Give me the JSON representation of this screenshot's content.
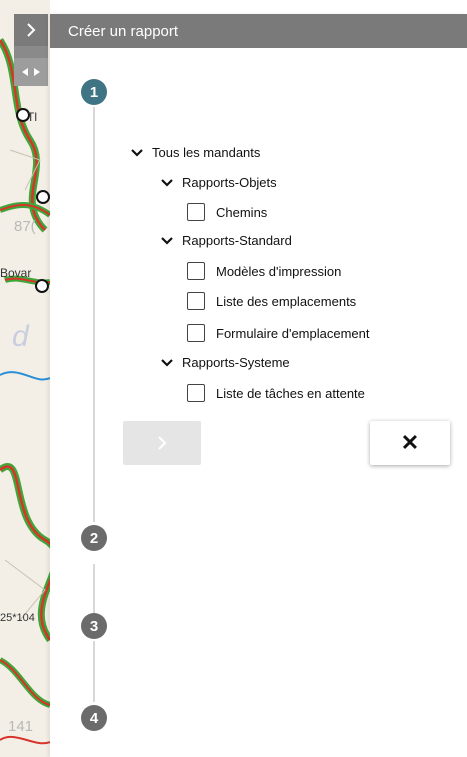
{
  "panel": {
    "title": "Créer un rapport",
    "expand_icon": "chevron-right-icon",
    "collapse_icon": "collapse-arrows-icon"
  },
  "steps": [
    {
      "number": "1",
      "state": "active"
    },
    {
      "number": "2",
      "state": "inactive"
    },
    {
      "number": "3",
      "state": "inactive"
    },
    {
      "number": "4",
      "state": "inactive"
    }
  ],
  "tree": {
    "root": {
      "label": "Tous les mandants",
      "expanded": true
    },
    "groups": [
      {
        "label": "Rapports-Objets",
        "expanded": true,
        "items": [
          {
            "label": "Chemins",
            "checked": false
          }
        ]
      },
      {
        "label": "Rapports-Standard",
        "expanded": true,
        "items": [
          {
            "label": "Modèles d'impression",
            "checked": false
          },
          {
            "label": "Liste des emplacements",
            "checked": false
          },
          {
            "label": "Formulaire d'emplacement",
            "checked": false
          }
        ]
      },
      {
        "label": "Rapports-Systeme",
        "expanded": true,
        "items": [
          {
            "label": "Liste de tâches en attente",
            "checked": false
          }
        ]
      }
    ]
  },
  "buttons": {
    "next": {
      "label": ">",
      "enabled": false
    },
    "close": {
      "label": "✕"
    }
  },
  "map": {
    "labels": {
      "tl": "Tl",
      "bovar": "Bovar",
      "n87": "87(",
      "coord": "25*104",
      "n141": "141",
      "d": "d"
    }
  },
  "colors": {
    "header": "#7a7a7a",
    "step_active": "#3f7485",
    "step_inactive": "#6b6b6b",
    "map_route_red": "#d9342b",
    "map_route_green": "#3fa63a"
  }
}
